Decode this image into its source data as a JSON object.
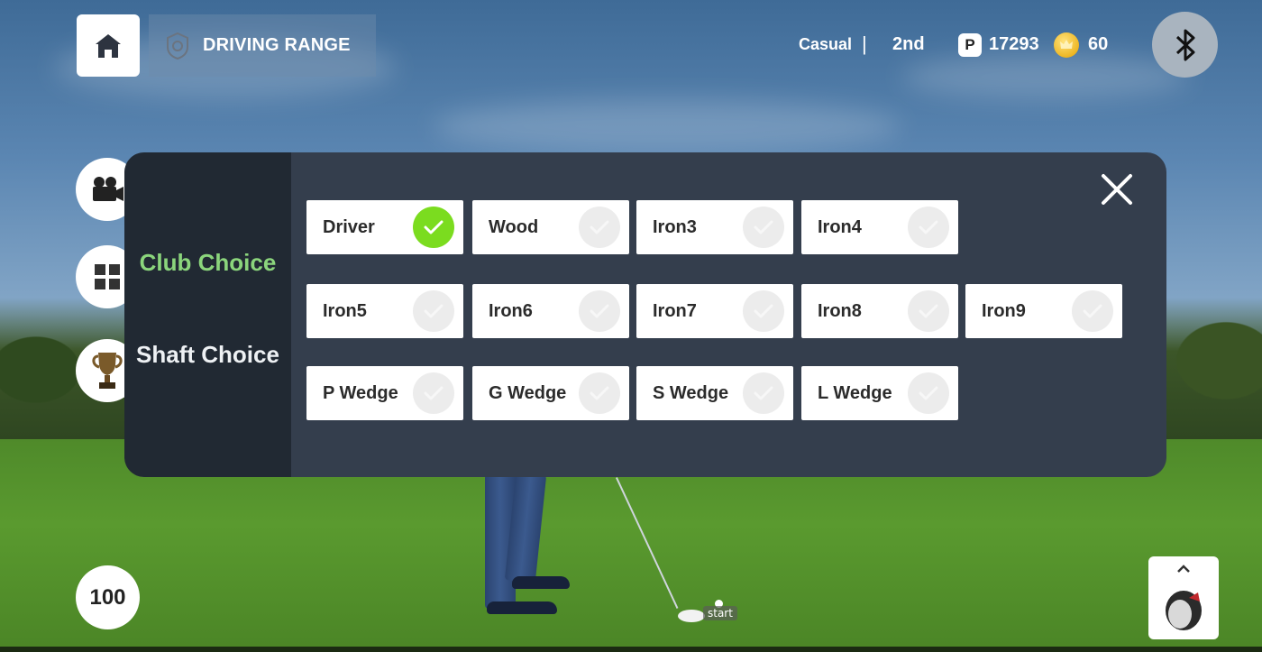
{
  "header": {
    "mode_title": "DRIVING RANGE",
    "game_mode": "Casual",
    "separator": "|",
    "rank": "2nd",
    "points_badge": "P",
    "points": "17293",
    "coins": "60"
  },
  "modal": {
    "tabs": [
      {
        "label": "Club Choice",
        "active": true
      },
      {
        "label": "Shaft Choice",
        "active": false
      }
    ],
    "clubs": [
      {
        "label": "Driver",
        "selected": true
      },
      {
        "label": "Wood",
        "selected": false
      },
      {
        "label": "Iron3",
        "selected": false
      },
      {
        "label": "Iron4",
        "selected": false
      },
      {
        "label": "Iron5",
        "selected": false
      },
      {
        "label": "Iron6",
        "selected": false
      },
      {
        "label": "Iron7",
        "selected": false
      },
      {
        "label": "Iron8",
        "selected": false
      },
      {
        "label": "Iron9",
        "selected": false
      },
      {
        "label": "P Wedge",
        "selected": false
      },
      {
        "label": "G Wedge",
        "selected": false
      },
      {
        "label": "S Wedge",
        "selected": false
      },
      {
        "label": "L Wedge",
        "selected": false
      }
    ]
  },
  "hud": {
    "power": "100",
    "ball_label": "start"
  },
  "colors": {
    "active_tab": "#8bd57c",
    "selected_check": "#7bdc1f",
    "modal_bg": "#343e4d",
    "sidebar_bg": "#212933"
  },
  "icons": [
    "home-icon",
    "crest-icon",
    "crown-coin-icon",
    "bluetooth-icon",
    "camera-icon",
    "grid-icon",
    "trophy-icon",
    "close-icon",
    "check-icon",
    "driver-club-icon",
    "chevron-up-icon"
  ]
}
